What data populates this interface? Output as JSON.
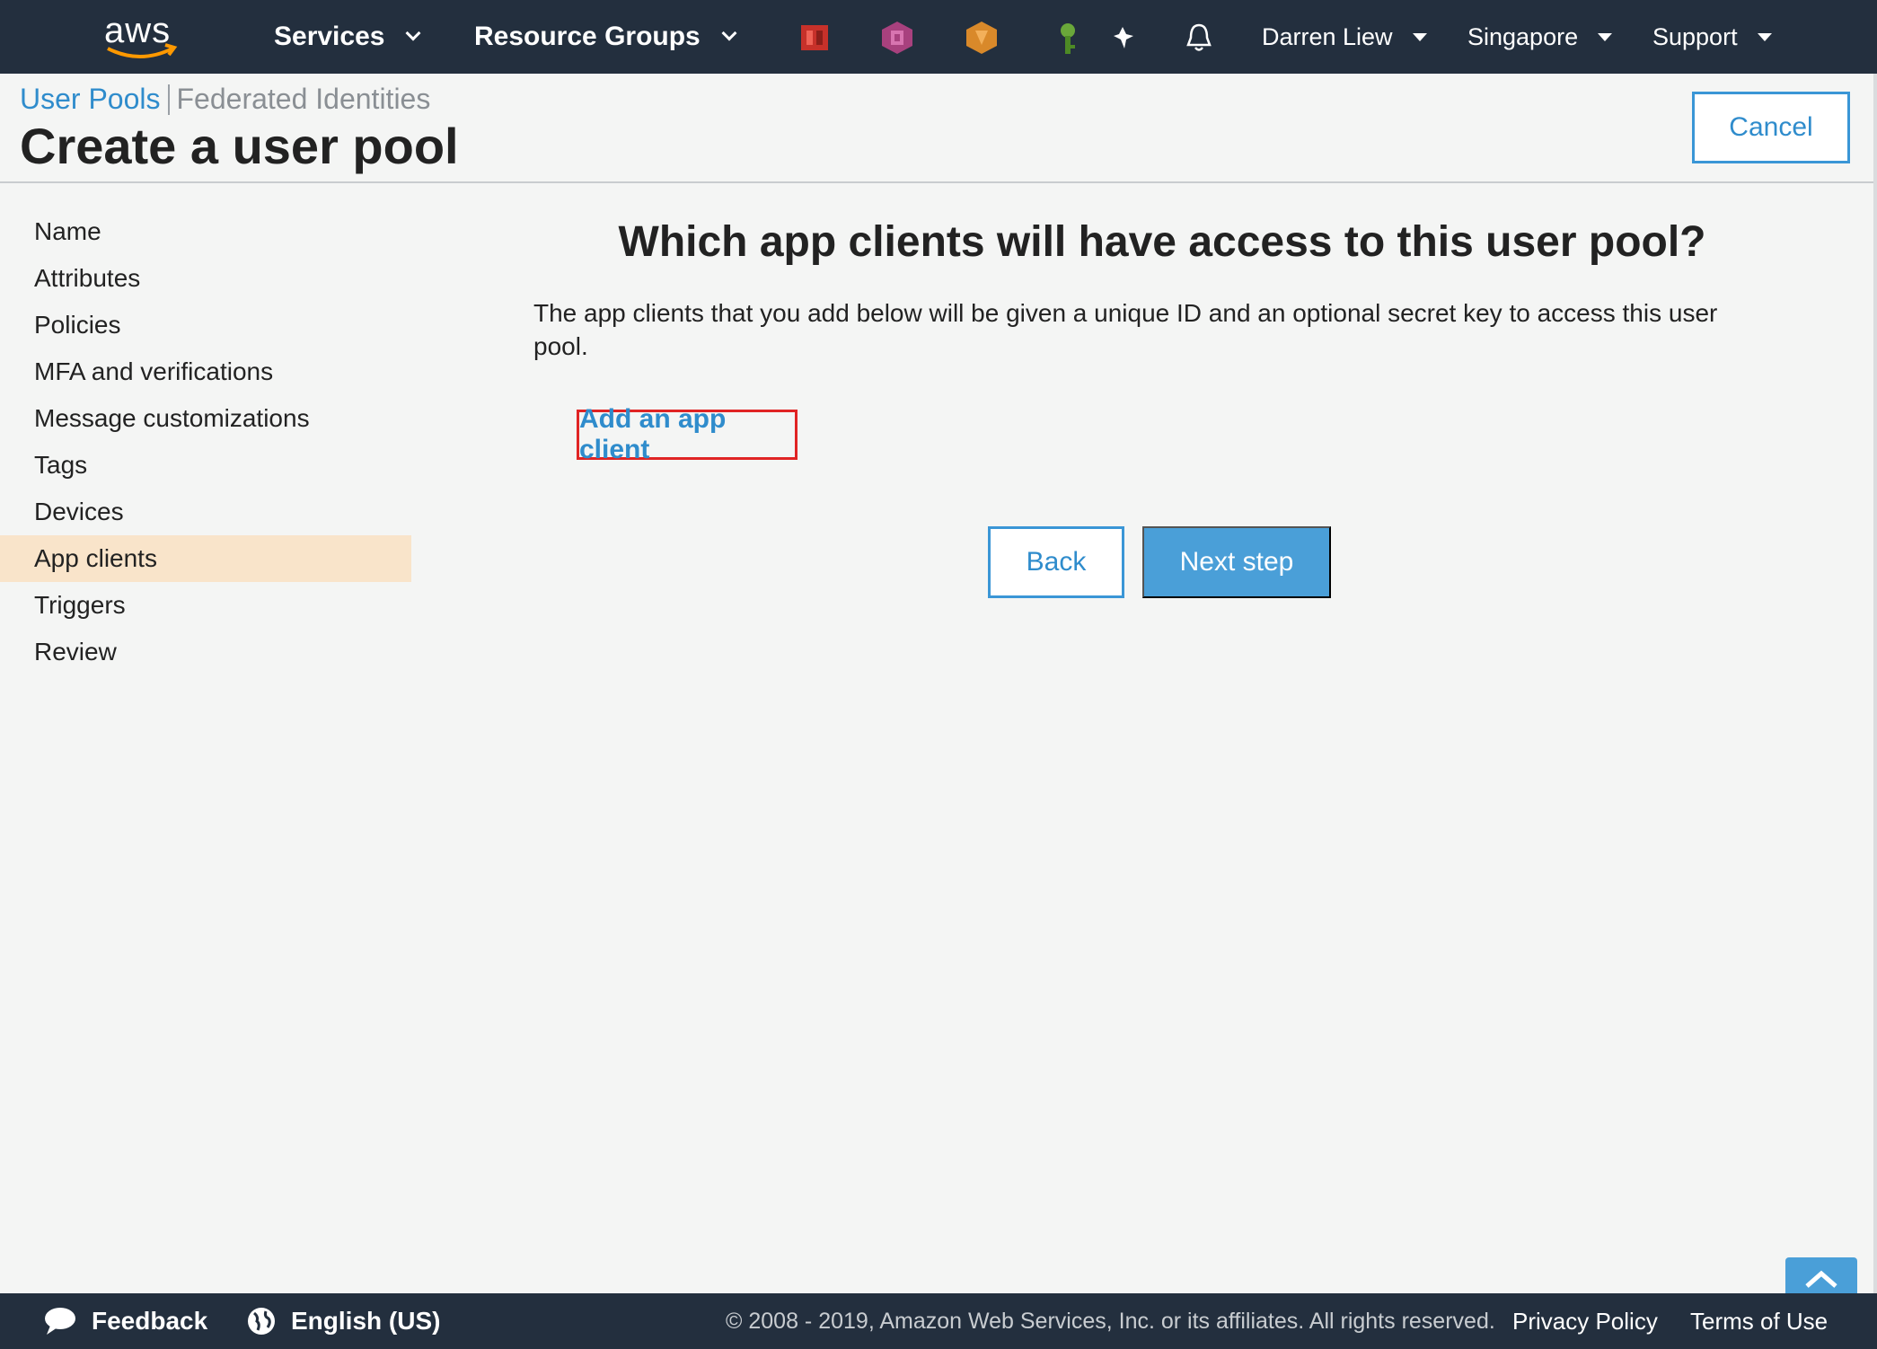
{
  "topnav": {
    "logo_text": "aws",
    "services_label": "Services",
    "resource_groups_label": "Resource Groups",
    "pinned_icons": [
      "aws-service-red-icon",
      "aws-service-pink-icon",
      "aws-service-orange-icon",
      "aws-service-green-key-icon"
    ],
    "user_label": "Darren Liew",
    "region_label": "Singapore",
    "support_label": "Support"
  },
  "header": {
    "breadcrumb_user_pools": "User Pools",
    "breadcrumb_federated": "Federated Identities",
    "title": "Create a user pool",
    "cancel_label": "Cancel"
  },
  "sidebar": {
    "items": [
      {
        "label": "Name"
      },
      {
        "label": "Attributes"
      },
      {
        "label": "Policies"
      },
      {
        "label": "MFA and verifications"
      },
      {
        "label": "Message customizations"
      },
      {
        "label": "Tags"
      },
      {
        "label": "Devices"
      },
      {
        "label": "App clients"
      },
      {
        "label": "Triggers"
      },
      {
        "label": "Review"
      }
    ],
    "active": "App clients"
  },
  "main": {
    "heading": "Which app clients will have access to this user pool?",
    "description": "The app clients that you add below will be given a unique ID and an optional secret key to access this user pool.",
    "add_client_label": "Add an app client",
    "back_label": "Back",
    "next_label": "Next step"
  },
  "footer": {
    "feedback_label": "Feedback",
    "language_label": "English (US)",
    "copyright": "© 2008 - 2019, Amazon Web Services, Inc. or its affiliates. All rights reserved.",
    "privacy_label": "Privacy Policy",
    "terms_label": "Terms of Use"
  },
  "colors": {
    "nav_bg": "#232f3e",
    "link_blue": "#2f8ccc",
    "primary_button": "#4a9fd8",
    "active_item_bg": "#f9e4ca",
    "highlight_red": "#e02424",
    "aws_orange": "#ff9900"
  }
}
